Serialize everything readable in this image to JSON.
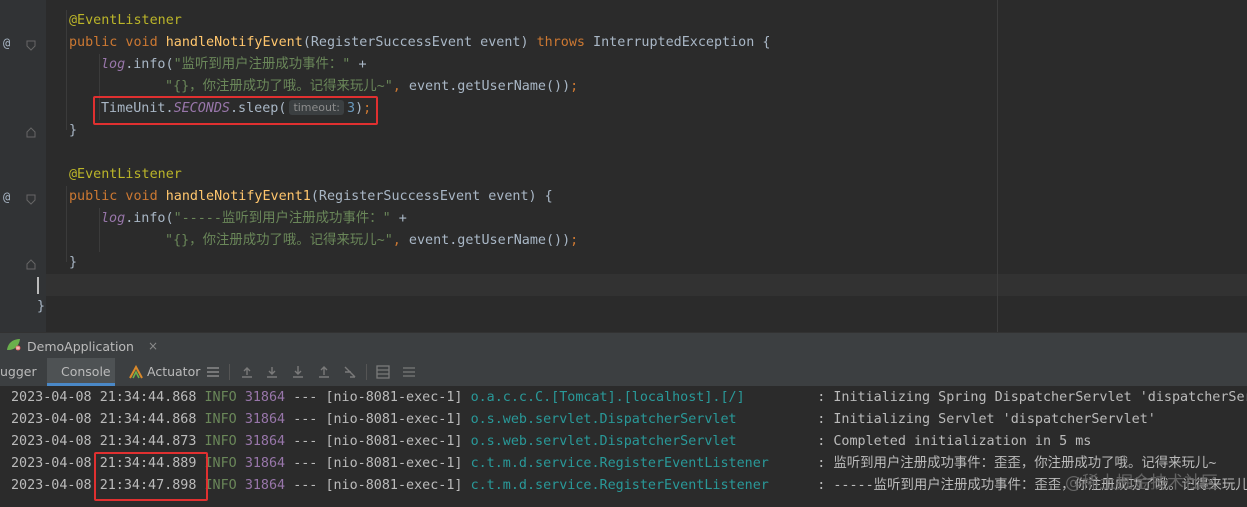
{
  "editor": {
    "lines": [
      {
        "parts": [
          {
            "c": "ann",
            "t": "@EventListener"
          }
        ]
      },
      {
        "parts": [
          {
            "c": "kw",
            "t": "public void "
          },
          {
            "c": "fn",
            "t": "handleNotifyEvent"
          },
          {
            "c": "",
            "t": "(RegisterSuccessEvent event) "
          },
          {
            "c": "kw",
            "t": "throws "
          },
          {
            "c": "",
            "t": "InterruptedException {"
          }
        ]
      },
      {
        "parts": [
          {
            "c": "logv",
            "t": "log"
          },
          {
            "c": "",
            "t": ".info("
          },
          {
            "c": "str",
            "t": "\"监听到用户注册成功事件：\" "
          },
          {
            "c": "",
            "t": "+"
          }
        ]
      },
      {
        "parts": [
          {
            "c": "str",
            "t": "\"{}，你注册成功了哦。记得来玩儿~\""
          },
          {
            "c": "kw",
            "t": ", "
          },
          {
            "c": "",
            "t": "event.getUserName())"
          },
          {
            "c": "kw",
            "t": ";"
          }
        ]
      },
      {
        "parts": [
          {
            "c": "",
            "t": "TimeUnit."
          },
          {
            "c": "cst",
            "t": "SECONDS"
          },
          {
            "c": "",
            "t": ".sleep("
          },
          {
            "c": "hint",
            "t": "timeout:"
          },
          {
            "c": "num",
            "t": "3"
          },
          {
            "c": "",
            "t": ")"
          },
          {
            "c": "kw",
            "t": ";"
          }
        ]
      },
      {
        "parts": [
          {
            "c": "",
            "t": "}"
          }
        ]
      },
      {
        "parts": []
      },
      {
        "parts": [
          {
            "c": "ann",
            "t": "@EventListener"
          }
        ]
      },
      {
        "parts": [
          {
            "c": "kw",
            "t": "public void "
          },
          {
            "c": "fn",
            "t": "handleNotifyEvent1"
          },
          {
            "c": "",
            "t": "(RegisterSuccessEvent event) {"
          }
        ]
      },
      {
        "parts": [
          {
            "c": "logv",
            "t": "log"
          },
          {
            "c": "",
            "t": ".info("
          },
          {
            "c": "str",
            "t": "\"-----监听到用户注册成功事件：\" "
          },
          {
            "c": "",
            "t": "+"
          }
        ]
      },
      {
        "parts": [
          {
            "c": "str",
            "t": "\"{}，你注册成功了哦。记得来玩儿~\""
          },
          {
            "c": "kw",
            "t": ", "
          },
          {
            "c": "",
            "t": "event.getUserName())"
          },
          {
            "c": "kw",
            "t": ";"
          }
        ]
      },
      {
        "parts": [
          {
            "c": "",
            "t": "}"
          }
        ]
      },
      {
        "parts": []
      },
      {
        "parts": [
          {
            "c": "",
            "t": "}"
          }
        ]
      }
    ],
    "gutter_marker": "@"
  },
  "run_panel": {
    "tab_label": "DemoApplication",
    "close_glyph": "×",
    "tabs": {
      "debugger": "ugger",
      "console": "Console",
      "actuator": "Actuator"
    }
  },
  "console": {
    "rows": [
      {
        "date": "2023-04-08",
        "time": "21:34:44.868",
        "level": "INFO",
        "pid": "31864",
        "sep": "---",
        "thread": "[nio-8081-exec-1]",
        "logger": "o.a.c.c.C.[Tomcat].[localhost].[/]",
        "msg": ": Initializing Spring DispatcherServlet 'dispatcherServlet'"
      },
      {
        "date": "2023-04-08",
        "time": "21:34:44.868",
        "level": "INFO",
        "pid": "31864",
        "sep": "---",
        "thread": "[nio-8081-exec-1]",
        "logger": "o.s.web.servlet.DispatcherServlet",
        "msg": ": Initializing Servlet 'dispatcherServlet'"
      },
      {
        "date": "2023-04-08",
        "time": "21:34:44.873",
        "level": "INFO",
        "pid": "31864",
        "sep": "---",
        "thread": "[nio-8081-exec-1]",
        "logger": "o.s.web.servlet.DispatcherServlet",
        "msg": ": Completed initialization in 5 ms"
      },
      {
        "date": "2023-04-08",
        "time": "21:34:44.889",
        "level": "INFO",
        "pid": "31864",
        "sep": "---",
        "thread": "[nio-8081-exec-1]",
        "logger": "c.t.m.d.service.RegisterEventListener",
        "msg": ": 监听到用户注册成功事件：歪歪，你注册成功了哦。记得来玩儿~"
      },
      {
        "date": "2023-04-08",
        "time": "21:34:47.898",
        "level": "INFO",
        "pid": "31864",
        "sep": "---",
        "thread": "[nio-8081-exec-1]",
        "logger": "c.t.m.d.service.RegisterEventListener",
        "msg": ": -----监听到用户注册成功事件：歪歪，你注册成功了哦。记得来玩儿~"
      }
    ]
  },
  "watermark": "@稀土掘金技术社区",
  "colors": {
    "highlight_box": "#e03030",
    "annotation": "#bbb529",
    "keyword": "#cc7832",
    "method": "#ffc66d",
    "string": "#6a8759",
    "constant": "#9876aa",
    "logger": "#299999"
  }
}
